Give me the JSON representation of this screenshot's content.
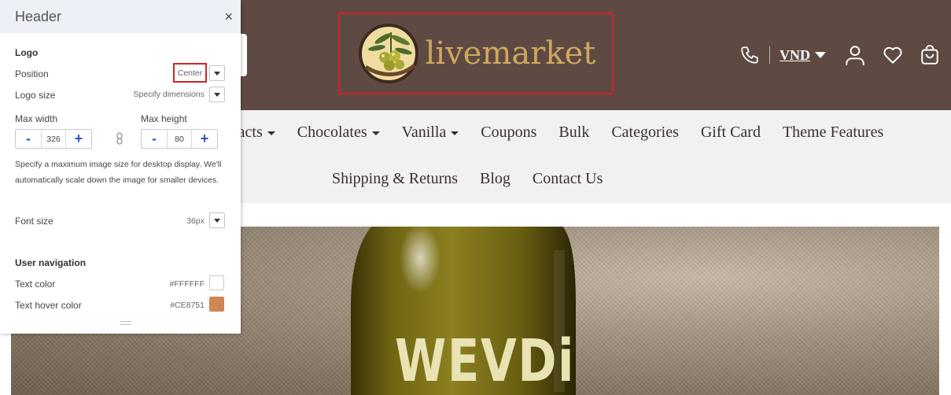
{
  "store": {
    "logo_text": "livemarket",
    "currency": "VND",
    "nav_row1": [
      {
        "label": "racts",
        "caret": true
      },
      {
        "label": "Chocolates",
        "caret": true
      },
      {
        "label": "Vanilla",
        "caret": true
      },
      {
        "label": "Coupons",
        "caret": false
      },
      {
        "label": "Bulk",
        "caret": false
      },
      {
        "label": "Categories",
        "caret": false
      },
      {
        "label": "Gift Card",
        "caret": false
      },
      {
        "label": "Theme Features",
        "caret": false
      }
    ],
    "nav_row2": [
      {
        "label": "Shipping & Returns"
      },
      {
        "label": "Blog"
      },
      {
        "label": "Contact Us"
      }
    ],
    "hero_label": "WEVDi",
    "colors": {
      "header_bg": "#5e4a42",
      "logo_gold": "#cfa760",
      "nav_bg": "#f1f1f3",
      "highlight": "#d0232a"
    }
  },
  "panel": {
    "title": "Header",
    "close": "×",
    "logo_section": "Logo",
    "position_label": "Position",
    "position_value": "Center",
    "logo_size_label": "Logo size",
    "logo_size_value": "Specify dimensions",
    "max_width_label": "Max width",
    "max_width_value": "326",
    "max_height_label": "Max height",
    "max_height_value": "80",
    "minus": "-",
    "plus": "+",
    "help_text": "Specify a maximum image size for desktop display. We'll automatically scale down the image for smaller devices.",
    "font_size_label": "Font size",
    "font_size_value": "36px",
    "user_nav_section": "User navigation",
    "text_color_label": "Text color",
    "text_color_value": "#FFFFFF",
    "text_hover_label": "Text hover color",
    "text_hover_value": "#CE8751",
    "accent": "#2c56c9"
  }
}
